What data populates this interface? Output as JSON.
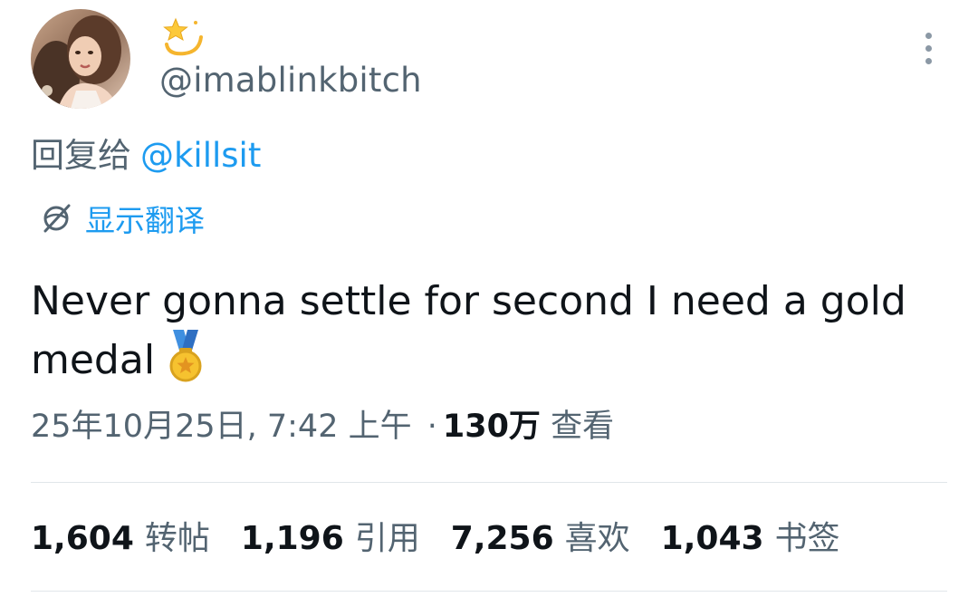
{
  "author": {
    "display_name_emoji": "dizzy-star-icon",
    "handle": "@imablinkbitch",
    "avatar_alt": "avatar"
  },
  "reply": {
    "prefix": "回复给",
    "mention": "@killsit"
  },
  "translate": {
    "label": "显示翻译",
    "icon": "globe-slash-icon"
  },
  "tweet": {
    "text": "Never gonna settle for second I need a gold medal",
    "emoji": "medal-icon"
  },
  "meta": {
    "timestamp": "25年10月25日, 7:42 上午",
    "separator": "·",
    "views_count": "130万",
    "views_label": "查看"
  },
  "stats": [
    {
      "count": "1,604",
      "label": "转帖"
    },
    {
      "count": "1,196",
      "label": "引用"
    },
    {
      "count": "7,256",
      "label": "喜欢"
    },
    {
      "count": "1,043",
      "label": "书签"
    }
  ],
  "colors": {
    "link": "#1d9bf0",
    "secondary_text": "#536471",
    "primary_text": "#0f1419",
    "divider": "#e1e6ea"
  }
}
